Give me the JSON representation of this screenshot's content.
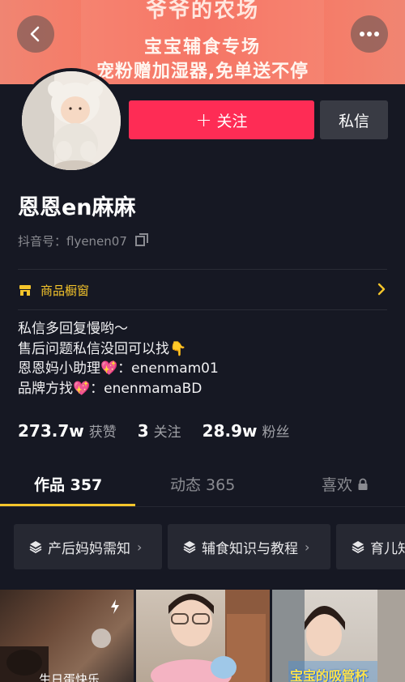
{
  "banner": {
    "top_text": "爷爷的农场",
    "line1": "宝宝辅食专场",
    "line2": "宠粉赠加湿器,免单送不停"
  },
  "header": {
    "back_icon": "chevron-left-icon",
    "more_icon": "more-dots-icon"
  },
  "profile": {
    "name": "恩恩en麻麻",
    "account_label": "抖音号：flyenen07",
    "follow_label": "关注",
    "message_label": "私信"
  },
  "shop": {
    "label": "商品橱窗",
    "icon": "shop-icon",
    "color": "#f5c52b"
  },
  "bio": {
    "lines": [
      "私信多回复慢哟～",
      "售后问题私信没回可以找👇",
      "恩恩妈小助理💖：enenmam01",
      "品牌方找💖：enenmamaBD"
    ]
  },
  "stats": [
    {
      "value": "273.7w",
      "label": "获赞"
    },
    {
      "value": "3",
      "label": "关注"
    },
    {
      "value": "28.9w",
      "label": "粉丝"
    }
  ],
  "tabs": [
    {
      "label": "作品 357",
      "active": true
    },
    {
      "label": "动态 365",
      "active": false
    },
    {
      "label": "喜欢",
      "active": false,
      "locked": true
    }
  ],
  "collections": [
    {
      "label": "产后妈妈需知"
    },
    {
      "label": "辅食知识与教程"
    },
    {
      "label": "育儿知"
    }
  ],
  "videos": [
    {
      "caption": "生日蛋快乐"
    },
    {
      "caption": ""
    },
    {
      "caption": "宝宝的吸管杯"
    }
  ],
  "colors": {
    "background": "#161823",
    "follow_button": "#fe2c55",
    "accent": "#f5c52b"
  }
}
